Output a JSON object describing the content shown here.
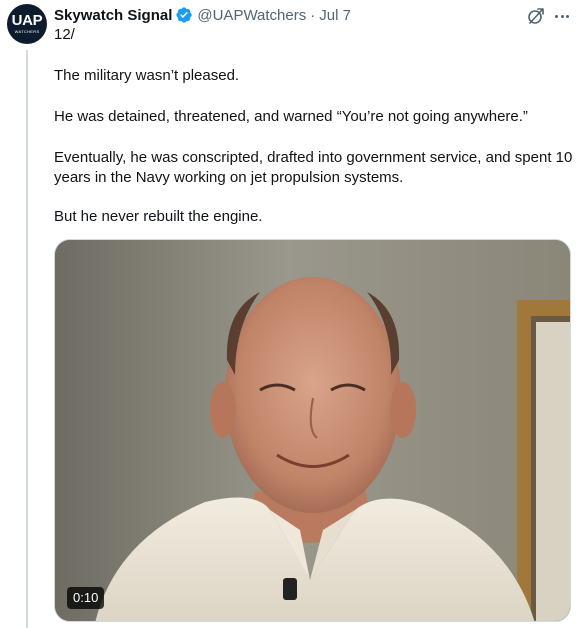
{
  "author": {
    "avatar_text": "UAP",
    "avatar_subtext": "WATCHERS",
    "name": "Skywatch Signal",
    "handle": "@UAPWatchers",
    "separator": "·",
    "date": "Jul 7",
    "verified": true
  },
  "tweet": {
    "lines": [
      "12/",
      "The military wasn’t pleased.",
      "He was detained, threatened, and warned “You’re not going anywhere.”",
      "Eventually, he was conscripted, drafted into government service, and spent 10 years in the Navy working on jet propulsion systems.",
      "But he never rebuilt the engine."
    ]
  },
  "media": {
    "type": "video",
    "duration": "0:10"
  },
  "icons": {
    "grok": "grok-icon",
    "more": "more-options-icon",
    "verified": "verified-badge-icon"
  },
  "colors": {
    "text": "#0f1419",
    "secondary": "#536471",
    "verified": "#1d9bf0",
    "thread_line": "#cfd9de"
  }
}
